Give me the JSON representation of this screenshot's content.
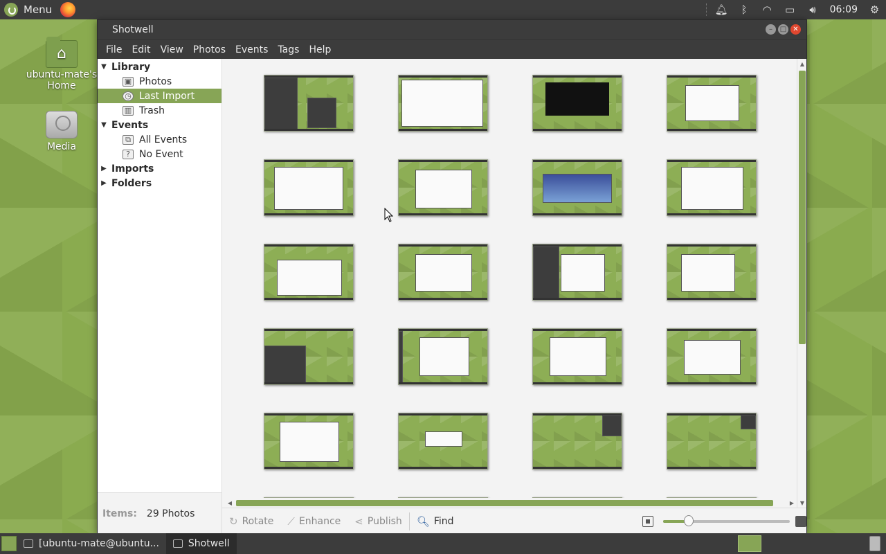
{
  "topbar": {
    "menu_label": "Menu",
    "clock": "06:09"
  },
  "desktop": {
    "icons": [
      {
        "label": "ubuntu-mate's Home"
      },
      {
        "label": "Media"
      }
    ]
  },
  "window": {
    "title": "Shotwell",
    "menu": [
      "File",
      "Edit",
      "View",
      "Photos",
      "Events",
      "Tags",
      "Help"
    ]
  },
  "sidebar": {
    "library_label": "Library",
    "library_items": [
      {
        "label": "Photos"
      },
      {
        "label": "Last Import",
        "selected": true
      },
      {
        "label": "Trash"
      }
    ],
    "events_label": "Events",
    "events_items": [
      {
        "label": "All Events"
      },
      {
        "label": "No Event"
      }
    ],
    "imports_label": "Imports",
    "folders_label": "Folders",
    "items_key": "Items:",
    "items_value": "29 Photos"
  },
  "toolbar": {
    "rotate": "Rotate",
    "enhance": "Enhance",
    "publish": "Publish",
    "find": "Find",
    "zoom_level": 0.2
  },
  "taskbar": {
    "tasks": [
      {
        "label": "[ubuntu-mate@ubuntu..."
      },
      {
        "label": "Shotwell"
      }
    ]
  },
  "colors": {
    "accent": "#87a556",
    "panel": "#3c3c3c",
    "close": "#e0472f"
  }
}
